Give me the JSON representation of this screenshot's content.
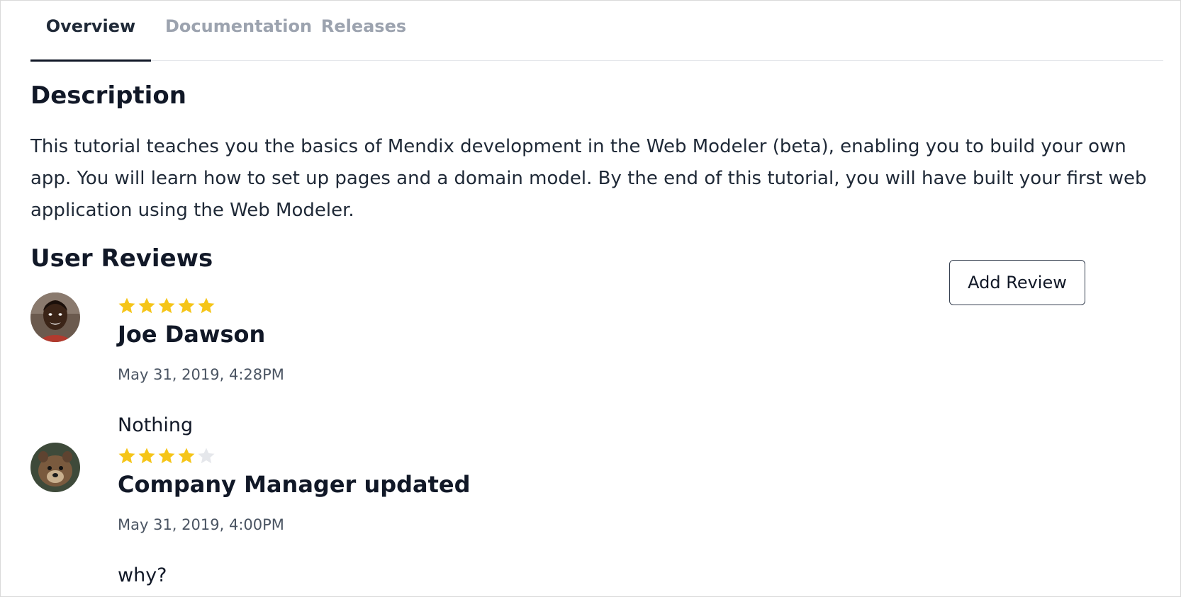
{
  "tabs": [
    {
      "label": "Overview",
      "active": true
    },
    {
      "label": "Documentation",
      "active": false
    },
    {
      "label": "Releases",
      "active": false
    }
  ],
  "description": {
    "title": "Description",
    "text": "This tutorial teaches you the basics of Mendix development in the Web Modeler (beta), enabling you to build your own app. You will learn how to set up pages and a domain model. By the end of this tutorial, you will have built your first web application using the Web Modeler."
  },
  "reviews": {
    "title": "User Reviews",
    "add_label": "Add Review",
    "items": [
      {
        "name": "Joe Dawson",
        "date": "May 31, 2019, 4:28PM",
        "text": "Nothing",
        "rating": 5,
        "avatar": "person-avatar"
      },
      {
        "name": "Company Manager updated",
        "date": "May 31, 2019, 4:00PM",
        "text": "why?",
        "rating": 4,
        "avatar": "animal-avatar"
      }
    ]
  },
  "colors": {
    "star_filled": "#f5c518",
    "star_empty": "#e5e7eb",
    "text": "#111827",
    "muted": "#9ca3af"
  }
}
